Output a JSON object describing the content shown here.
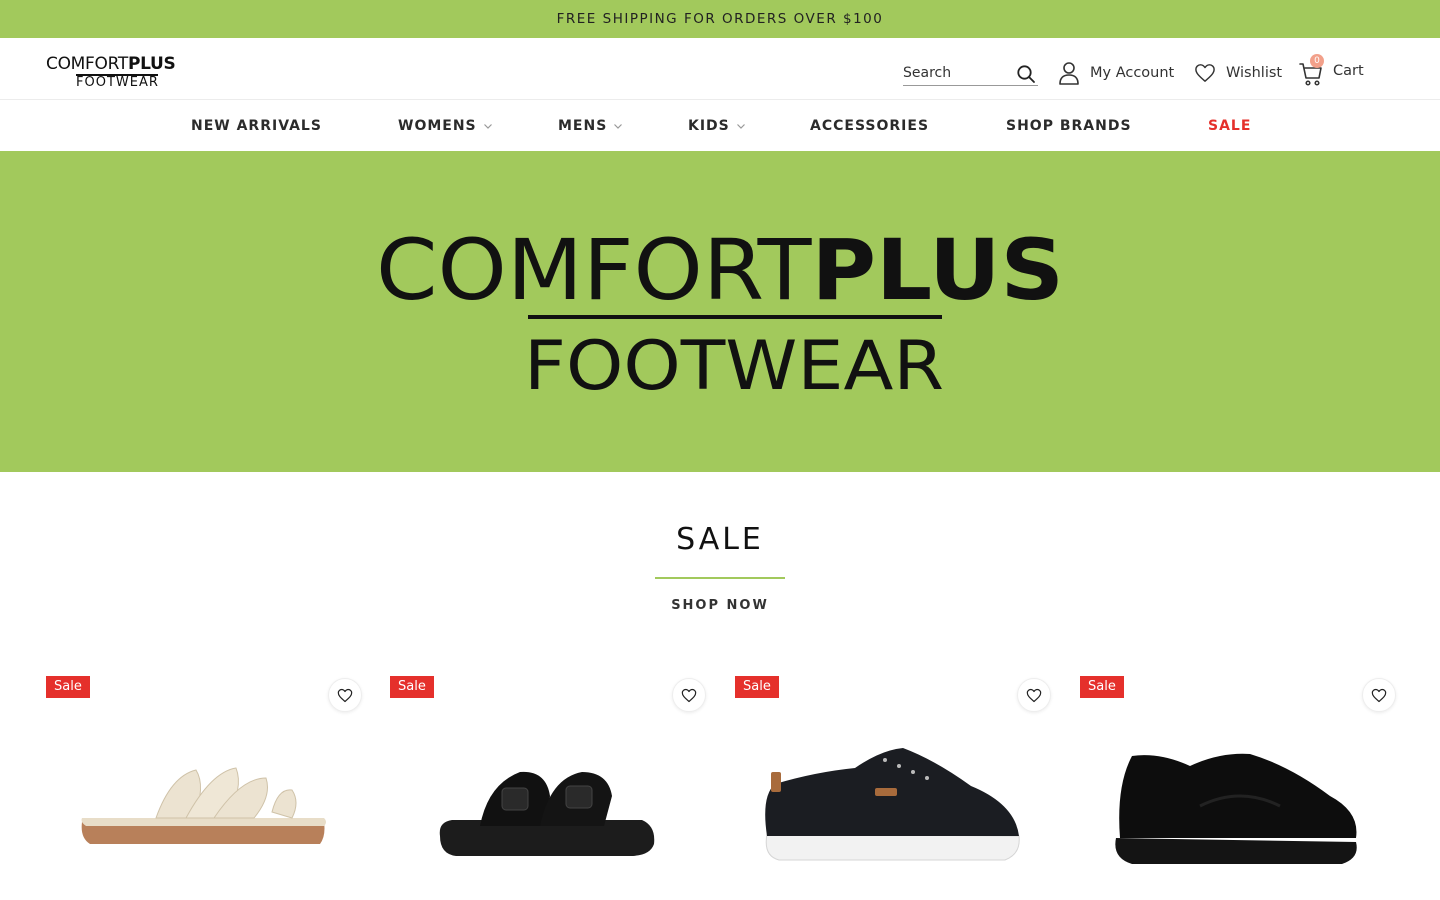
{
  "promo": {
    "text": "FREE SHIPPING FOR ORDERS OVER $100"
  },
  "header": {
    "logo": {
      "top_light": "COMFORT",
      "top_bold": "PLUS",
      "bottom": "FOOTWEAR"
    },
    "search": {
      "placeholder": "Search"
    },
    "account_label": "My Account",
    "wishlist_label": "Wishlist",
    "cart_label": "Cart",
    "cart_count": "0"
  },
  "nav": {
    "items": [
      {
        "label": "NEW ARRIVALS"
      },
      {
        "label": "WOMENS"
      },
      {
        "label": "MENS"
      },
      {
        "label": "KIDS"
      },
      {
        "label": "ACCESSORIES"
      },
      {
        "label": "SHOP BRANDS"
      },
      {
        "label": "SALE"
      }
    ]
  },
  "hero": {
    "line1_light": "COMFORT",
    "line1_bold": "PLUS",
    "line2": "FOOTWEAR"
  },
  "section": {
    "title": "SALE",
    "cta": "SHOP NOW"
  },
  "products": [
    {
      "badge": "Sale",
      "image": "strappy-sandal"
    },
    {
      "badge": "Sale",
      "image": "black-buckle-slide"
    },
    {
      "badge": "Sale",
      "image": "black-leather-sneaker"
    },
    {
      "badge": "Sale",
      "image": "black-running-shoe"
    }
  ],
  "colors": {
    "brand_green": "#a2c95c",
    "sale_red": "#e5302b",
    "badge_peach": "#f2a08a"
  }
}
